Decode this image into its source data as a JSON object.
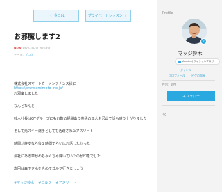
{
  "nav": {
    "prev_label": "今日は",
    "next_label": "プライベートレッスン"
  },
  "article": {
    "title": "お邪魔します2",
    "badge": "NEW!",
    "date": "2022-10-02 20:58:01",
    "theme_prefix": "テーマ：",
    "theme_link": "ブログ",
    "lines": [
      "株式会社スマートカーメンテナンス様に",
      "お邪魔しました",
      "なんとなんと",
      "鈴木社長はGTグループにもお数の経験あり共通の知人も沢山で話も盛り上がりました",
      "そして元スキー選手としても活躍されたアスリート",
      "時間が許すなら後２時間でらいはお話したかった",
      "会社にある車がめちゃくちゃ輝いていたのが印象でした",
      "次回は森下さんを含めてゴルフ行きましょう"
    ],
    "link": "https://www.amimoto-ino.jp/",
    "tags": [
      "#マッジ鈴木",
      "#ゴルフ",
      "#アスリート"
    ]
  },
  "sidebar": {
    "heading": "Profile",
    "name": "マッジ鈴木",
    "official_label": "Amebaオフィシャルブロガー",
    "official_icon": "checkmark-icon",
    "links": {
      "categories": "ジャンル",
      "profile": "プロフィール",
      "other": "ピグの部屋"
    },
    "info_label": "性別：男性",
    "follow_label": "＋フォロー",
    "follow_icon": "plus-icon",
    "follower_count": "40",
    "accent": "#29a9e0"
  }
}
